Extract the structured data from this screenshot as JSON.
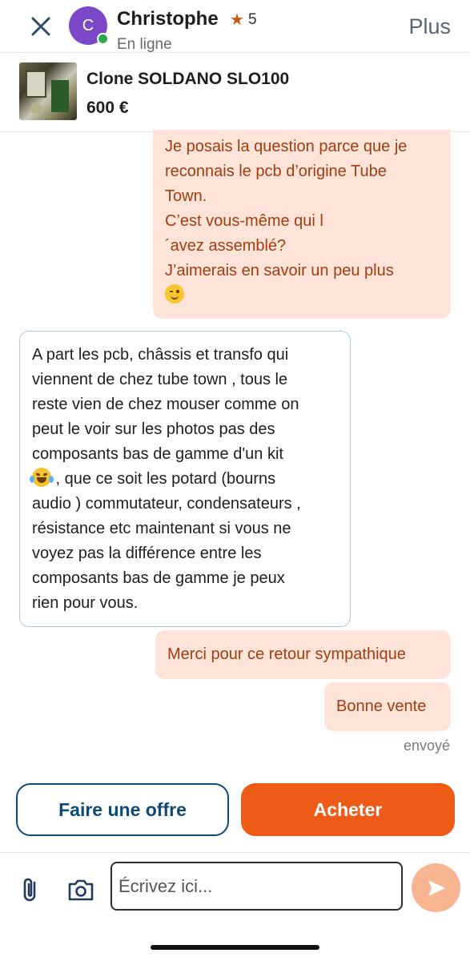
{
  "header": {
    "avatar_initial": "C",
    "contact_name": "Christophe",
    "rating": "5",
    "status": "En ligne",
    "more_label": "Plus"
  },
  "listing": {
    "title": "Clone SOLDANO SLO100",
    "price": "600 €"
  },
  "messages": {
    "m1": {
      "lines": [
        "Je posais la question parce que je",
        "reconnais le pcb d’origine Tube",
        "Town.",
        "C’est vous-même qui l",
        "´avez assemblé?",
        "J’aimerais en savoir un peu plus"
      ],
      "emoji": "winking-face"
    },
    "m2": {
      "lines": [
        "A part les pcb, châssis et transfo qui",
        "viennent de chez tube town , tous le",
        "reste vien de chez mouser comme on",
        "peut le voir sur les photos pas des",
        "composants bas de gamme d'un kit"
      ],
      "emoji_line_rest": " , que ce soit les potard (bourns",
      "lines_after": [
        "audio ) commutateur, condensateurs ,",
        "résistance etc maintenant si vous ne",
        "voyez pas la différence entre les",
        "composants bas de gamme je peux",
        "rien pour vous."
      ],
      "emoji": "tears-of-joy-face"
    },
    "m3": "Merci pour ce retour sympathique",
    "m4": "Bonne vente",
    "delivery_status": "envoyé"
  },
  "actions": {
    "offer_label": "Faire une offre",
    "buy_label": "Acheter"
  },
  "composer": {
    "placeholder": "Écrivez ici..."
  },
  "colors": {
    "accent": "#ee5b17",
    "outgoing_bg": "#fde3d8",
    "outgoing_text": "#a33d10",
    "offer_border": "#0e4b74",
    "avatar": "#7b48c8",
    "online": "#2ea84f"
  }
}
